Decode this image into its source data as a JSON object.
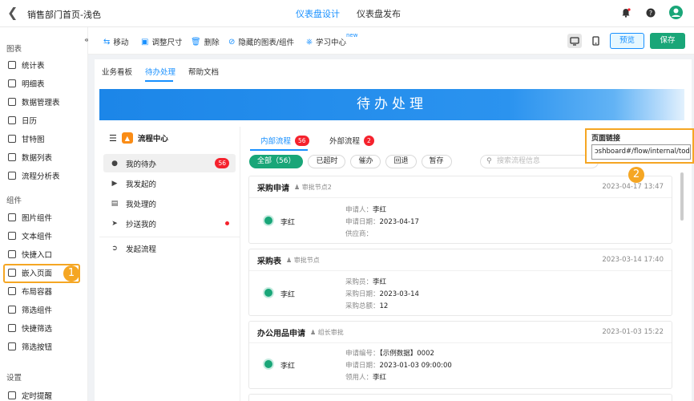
{
  "header": {
    "title": "销售部门首页-浅色",
    "tabs": [
      "仪表盘设计",
      "仪表盘发布"
    ]
  },
  "sidebar": {
    "section_charts": "图表",
    "charts": [
      "统计表",
      "明细表",
      "数据管理表",
      "日历",
      "甘特图",
      "数据列表",
      "流程分析表"
    ],
    "section_components": "组件",
    "components": [
      "图片组件",
      "文本组件",
      "快捷入口",
      "嵌入页面",
      "布局容器",
      "筛选组件",
      "快捷筛选",
      "筛选按钮"
    ],
    "section_settings": "设置",
    "settings": [
      "定时提醒"
    ]
  },
  "toolbar": {
    "move": "移动",
    "resize": "调整尺寸",
    "delete": "删除",
    "hidden": "隐藏的图表/组件",
    "learn": "学习中心",
    "new_tag": "new",
    "preview": "预览",
    "save": "保存"
  },
  "page_tabs": [
    "业务看板",
    "待办处理",
    "帮助文档"
  ],
  "banner": "待办处理",
  "flow": {
    "center": "流程中心",
    "items": [
      {
        "label": "我的待办",
        "count": "56"
      },
      {
        "label": "我发起的"
      },
      {
        "label": "我处理的"
      },
      {
        "label": "抄送我的"
      },
      {
        "label": "发起流程"
      }
    ],
    "tabs": [
      {
        "label": "内部流程",
        "count": "56"
      },
      {
        "label": "外部流程",
        "count": "2"
      }
    ],
    "filters": [
      "全部（56）",
      "已超时",
      "催办",
      "回退",
      "暂存"
    ],
    "search_placeholder": "搜索流程信息"
  },
  "cards": [
    {
      "title": "采购申请",
      "node": "审批节点2",
      "date": "2023-04-17 13:47",
      "user": "李红",
      "fields": [
        {
          "k": "申请人：",
          "v": "李红"
        },
        {
          "k": "申请日期：",
          "v": "2023-04-17"
        },
        {
          "k": "供应商：",
          "v": ""
        }
      ]
    },
    {
      "title": "采购表",
      "node": "审批节点",
      "date": "2023-03-14 17:40",
      "user": "李红",
      "fields": [
        {
          "k": "采购员：",
          "v": "李红"
        },
        {
          "k": "采购日期：",
          "v": "2023-03-14"
        },
        {
          "k": "采购总额：",
          "v": "12"
        }
      ]
    },
    {
      "title": "办公用品申请",
      "node": "组长审批",
      "date": "2023-01-03 15:22",
      "user": "李红",
      "fields": [
        {
          "k": "申请编号：",
          "v": "【示例数据】0002"
        },
        {
          "k": "申请日期：",
          "v": "2023-01-03 09:00:00"
        },
        {
          "k": "领用人：",
          "v": "李红"
        }
      ]
    }
  ],
  "popover": {
    "title": "页面链接",
    "value": "ɔshboard#/flow/internal/todo"
  },
  "callouts": [
    "1",
    "2"
  ],
  "colors": {
    "accent": "#1890ff",
    "save": "#19a678",
    "highlight": "#f5a623",
    "badge": "#f5222d"
  }
}
